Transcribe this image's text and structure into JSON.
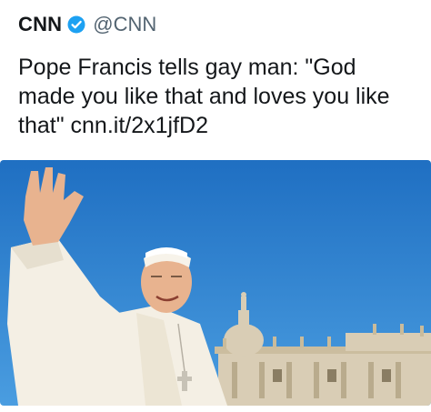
{
  "tweet": {
    "author_name": "CNN",
    "author_handle": "@CNN",
    "verified_icon": "verified-badge-icon",
    "text": "Pope Francis tells gay man: \"God made you like that and loves you like that\" cnn.it/2x1jfD2"
  },
  "media": {
    "description_icon": "photo",
    "colors": {
      "sky": "#2a86d6",
      "sky_top": "#1f6fc2",
      "robe": "#f4efe4",
      "skin": "#e8b38f",
      "building": "#d9cdb5"
    }
  }
}
